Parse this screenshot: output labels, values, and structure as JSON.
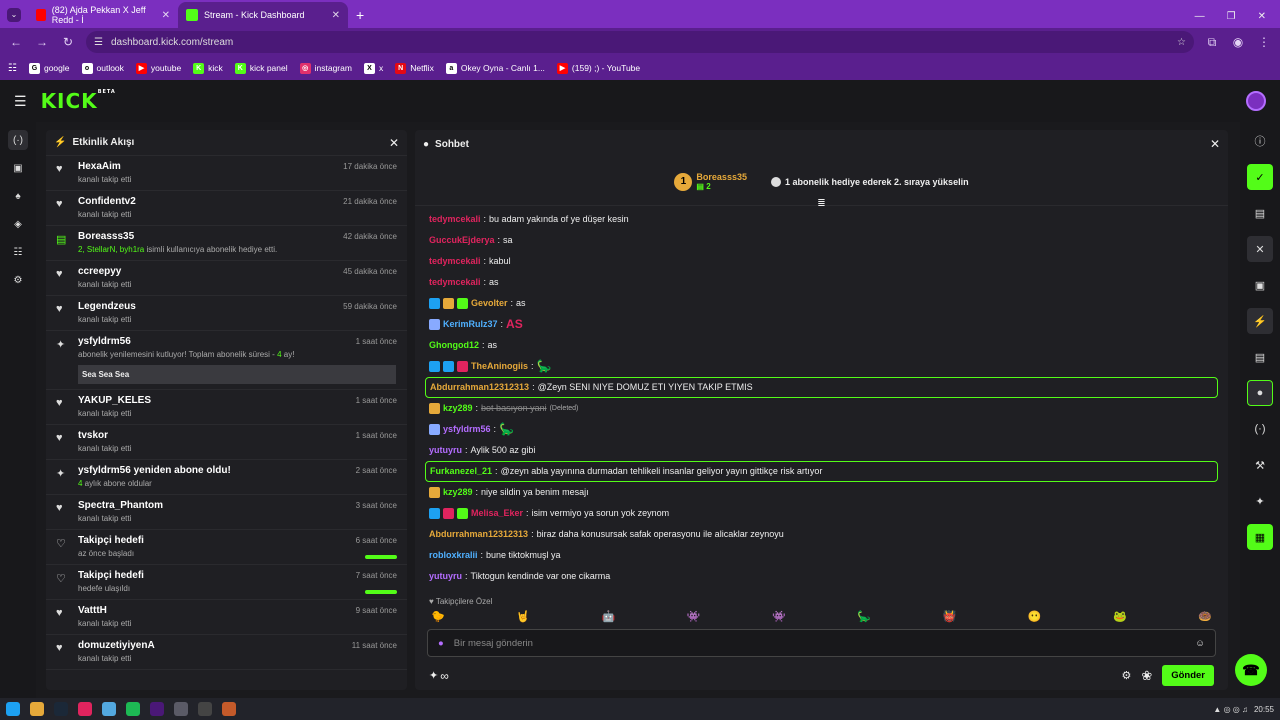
{
  "browser": {
    "tabs": [
      {
        "title": "(82) Ajda Pekkan X Jeff Redd - İ",
        "color": "#ff0000"
      },
      {
        "title": "Stream - Kick Dashboard",
        "color": "#53fc18"
      }
    ],
    "url": "dashboard.kick.com/stream",
    "bookmarks": [
      {
        "label": "google",
        "icon": "G",
        "color": "#fff"
      },
      {
        "label": "outlook",
        "icon": "o",
        "color": "#fff"
      },
      {
        "label": "youtube",
        "icon": "▶",
        "color": "#ff0000"
      },
      {
        "label": "kick",
        "icon": "K",
        "color": "#53fc18"
      },
      {
        "label": "kick panel",
        "icon": "K",
        "color": "#53fc18"
      },
      {
        "label": "instagram",
        "icon": "◎",
        "color": "#e1306c"
      },
      {
        "label": "x",
        "icon": "X",
        "color": "#fff"
      },
      {
        "label": "Netflix",
        "icon": "N",
        "color": "#e50914"
      },
      {
        "label": "Okey Oyna - Canlı 1...",
        "icon": "a",
        "color": "#fff"
      },
      {
        "label": "(159) ;) - YouTube",
        "icon": "▶",
        "color": "#ff0000"
      }
    ]
  },
  "app": {
    "logo": "KICK",
    "beta": "BETA"
  },
  "activity": {
    "title": "Etkinlik Akışı",
    "events": [
      {
        "name": "HexaAim",
        "sub": "kanalı takip etti",
        "time": "17 dakika önce",
        "icon": "♥"
      },
      {
        "name": "Confidentv2",
        "sub": "kanalı takip etti",
        "time": "21 dakika önce",
        "icon": "♥"
      },
      {
        "name": "Boreasss35",
        "sub_green": "2, StellarN, byh1ra",
        "sub": " isimli kullanıcıya abonelik hediye etti.",
        "time": "42 dakika önce",
        "icon": "▤"
      },
      {
        "name": "ccreepyy",
        "sub": "kanalı takip etti",
        "time": "45 dakika önce",
        "icon": "♥"
      },
      {
        "name": "Legendzeus",
        "sub": "kanalı takip etti",
        "time": "59 dakika önce",
        "icon": "♥"
      },
      {
        "name": "ysfyldrm56",
        "sub": "abonelik yenilemesini kutluyor! Toplam abonelik süresi - ",
        "sub_green": "4",
        "sub_end": " ay!",
        "time": "1 saat önce",
        "icon": "✦",
        "message": "Sea Sea Sea"
      },
      {
        "name": "YAKUP_KELES",
        "sub": "kanalı takip etti",
        "time": "1 saat önce",
        "icon": "♥"
      },
      {
        "name": "tvskor",
        "sub": "kanalı takip etti",
        "time": "1 saat önce",
        "icon": "♥"
      },
      {
        "name": "ysfyldrm56 yeniden abone oldu!",
        "sub_green": "4",
        "sub": " aylık abone oldular",
        "time": "2 saat önce",
        "icon": "✦"
      },
      {
        "name": "Spectra_Phantom",
        "sub": "kanalı takip etti",
        "time": "3 saat önce",
        "icon": "♥"
      },
      {
        "name": "Takipçi hedefi",
        "sub": "az önce başladı",
        "time": "6 saat önce",
        "icon": "♡",
        "progress": 1
      },
      {
        "name": "Takipçi hedefi",
        "sub": "hedefe ulaşıldı",
        "time": "7 saat önce",
        "icon": "♡",
        "progress": 1
      },
      {
        "name": "VatttH",
        "sub": "kanalı takip etti",
        "time": "9 saat önce",
        "icon": "♥"
      },
      {
        "name": "domuzetiyiyenA",
        "sub": "kanalı takip etti",
        "time": "11 saat önce",
        "icon": "♥"
      }
    ]
  },
  "chat": {
    "title": "Sohbet",
    "pinned": {
      "user": "Boreasss35",
      "count": "2",
      "rank": "1",
      "promo": "1 abonelik hediye ederek 2. sıraya yükselin"
    },
    "messages": [
      {
        "user": "tedymcekali",
        "color": "#e0245e",
        "text": "bu adam yakında of ye düşer kesin"
      },
      {
        "user": "GuccukEjderya",
        "color": "#e0245e",
        "text": "sa"
      },
      {
        "user": "tedymcekali",
        "color": "#e0245e",
        "text": "kabul"
      },
      {
        "user": "tedymcekali",
        "color": "#e0245e",
        "text": "as"
      },
      {
        "user": "Gevolter",
        "color": "#e6a93a",
        "text": "as",
        "badges": [
          "#1da1f2",
          "#e6a93a",
          "#53fc18"
        ]
      },
      {
        "user": "KerimRulz37",
        "color": "#4fb0ff",
        "text": "",
        "emote": "AS",
        "badges": [
          "#88aaff"
        ]
      },
      {
        "user": "Ghongod12",
        "color": "#53fc18",
        "text": "as"
      },
      {
        "user": "TheAninogiis",
        "color": "#e6a93a",
        "text": "",
        "emote": "🦕",
        "badges": [
          "#1da1f2",
          "#1da1f2",
          "#e0245e"
        ]
      },
      {
        "user": "Abdurrahman12312313",
        "color": "#e6a93a",
        "text": "@Zeyn SENI NIYE DOMUZ ETI YIYEN TAKIP ETMIS",
        "hl": true
      },
      {
        "user": "kzy289",
        "color": "#53fc18",
        "text": "bot basıyon yani",
        "deleted": "(Deleted)",
        "badges": [
          "#e6a93a"
        ]
      },
      {
        "user": "ysfyldrm56",
        "color": "#b46dff",
        "text": "",
        "emote": "🦕",
        "badges": [
          "#88aaff"
        ]
      },
      {
        "user": "yutuyru",
        "color": "#b46dff",
        "text": "Aylik 500 az gibi"
      },
      {
        "user": "Furkanezel_21",
        "color": "#53fc18",
        "text": "@zeyn abla yayınına durmadan tehlikeli insanlar geliyor yayın gittikçe risk artıyor",
        "hl": true
      },
      {
        "user": "kzy289",
        "color": "#53fc18",
        "text": "niye sildin ya benim mesajı",
        "badges": [
          "#e6a93a"
        ]
      },
      {
        "user": "Melisa_Eker",
        "color": "#e0245e",
        "text": "isim vermiyo ya sorun yok zeynom",
        "badges": [
          "#1da1f2",
          "#e0245e",
          "#53fc18"
        ]
      },
      {
        "user": "Abdurrahman12312313",
        "color": "#e6a93a",
        "text": "biraz daha konusursak safak operasyonu ile alicaklar zeynoyu"
      },
      {
        "user": "robloxkralii",
        "color": "#4fb0ff",
        "text": "bune tiktokmuşl ya"
      },
      {
        "user": "yutuyru",
        "color": "#b46dff",
        "text": "Tiktogun kendinde var one cikarma"
      }
    ],
    "followers_only": "Takipçilere Özel",
    "emotes": [
      "🐤",
      "🤘",
      "🤖",
      "👾",
      "👾",
      "🦕",
      "👹",
      "😶",
      "🐸",
      "🍩"
    ],
    "placeholder": "Bir mesaj gönderin",
    "send": "Gönder",
    "infinity": "∞"
  },
  "taskbar": {
    "time": "20:55"
  }
}
